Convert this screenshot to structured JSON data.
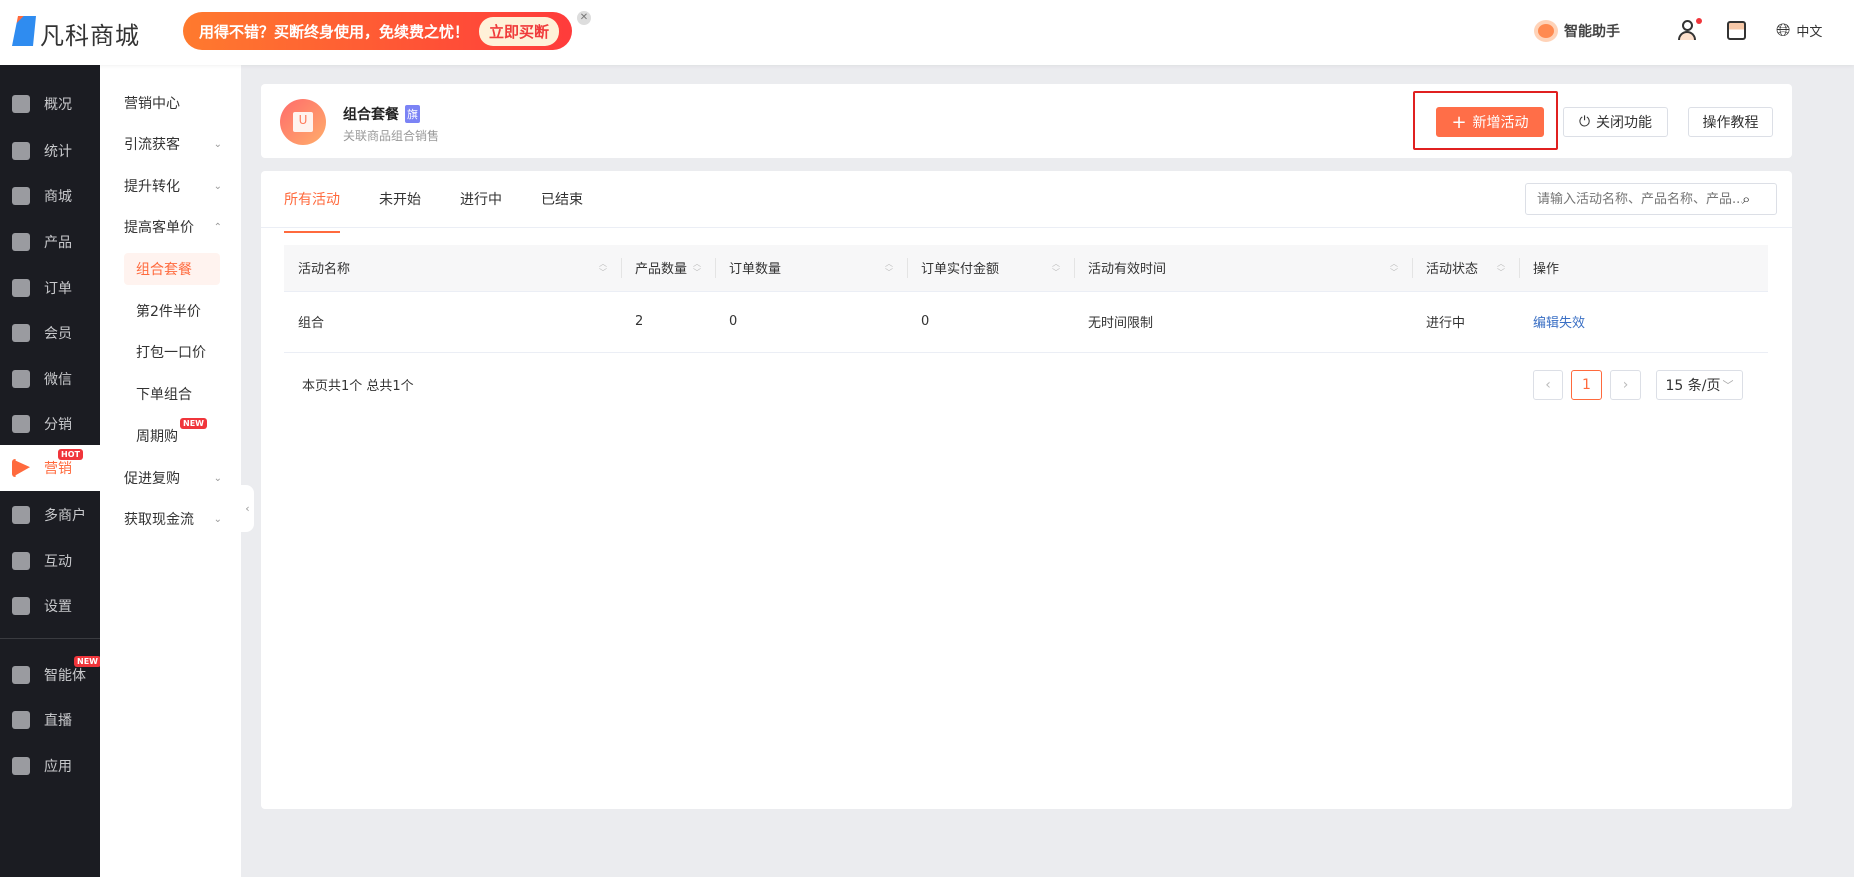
{
  "header": {
    "logo": "凡科商城",
    "banner_text": "用得不错？买断终身使用，免续费之忧！",
    "banner_button": "立即买断",
    "assistant": "智能助手",
    "language": "中文"
  },
  "sidebar": {
    "items": [
      {
        "label": "概况",
        "icon": "layers-icon"
      },
      {
        "label": "统计",
        "icon": "chart-icon"
      },
      {
        "label": "商城",
        "icon": "shop-bag-icon"
      },
      {
        "label": "产品",
        "icon": "grid-icon"
      },
      {
        "label": "订单",
        "icon": "clipboard-icon"
      },
      {
        "label": "会员",
        "icon": "crown-icon"
      },
      {
        "label": "微信",
        "icon": "chat-icon"
      },
      {
        "label": "分销",
        "icon": "users-icon"
      },
      {
        "label": "营销",
        "icon": "flag-icon",
        "badge": "HOT",
        "active": true
      },
      {
        "label": "多商户",
        "icon": "store-plus-icon"
      },
      {
        "label": "互动",
        "icon": "people-icon"
      },
      {
        "label": "设置",
        "icon": "gear-icon"
      },
      {
        "label": "智能体",
        "icon": "cube-icon",
        "badge": "NEW"
      },
      {
        "label": "直播",
        "icon": "tv-icon"
      },
      {
        "label": "应用",
        "icon": "apps-icon"
      }
    ]
  },
  "submenu": {
    "items": [
      {
        "label": "营销中心"
      },
      {
        "label": "引流获客",
        "chev": "⌄"
      },
      {
        "label": "提升转化",
        "chev": "⌄"
      },
      {
        "label": "提高客单价",
        "chev": "⌃"
      },
      {
        "label": "组合套餐",
        "child": true,
        "active": true
      },
      {
        "label": "第2件半价",
        "child": true
      },
      {
        "label": "打包一口价",
        "child": true
      },
      {
        "label": "下单组合",
        "child": true
      },
      {
        "label": "周期购",
        "child": true,
        "badge": "NEW"
      },
      {
        "label": "促进复购",
        "chev": "⌄"
      },
      {
        "label": "获取现金流",
        "chev": "⌄"
      }
    ]
  },
  "feature": {
    "title": "组合套餐",
    "tag": "旗",
    "subtitle": "关联商品组合销售",
    "add_button": "新增活动",
    "close_button": "关闭功能",
    "tutorial_button": "操作教程"
  },
  "tabs": [
    "所有活动",
    "未开始",
    "进行中",
    "已结束"
  ],
  "search": {
    "placeholder": "请输入活动名称、产品名称、产品..."
  },
  "table": {
    "columns": [
      "活动名称",
      "产品数量",
      "订单数量",
      "订单实付金额",
      "活动有效时间",
      "活动状态",
      "操作"
    ],
    "rows": [
      [
        "组合",
        "2",
        "0",
        "0",
        "无时间限制",
        "进行中",
        "编辑失效"
      ]
    ]
  },
  "footer": {
    "summary": "本页共1个 总共1个",
    "page": "1",
    "page_size": "15 条/页"
  },
  "colors": {
    "accent": "#ff6a3d",
    "link": "#3a6fc4",
    "sidebar": "#1b1c22",
    "highlight_box": "#e02020"
  }
}
